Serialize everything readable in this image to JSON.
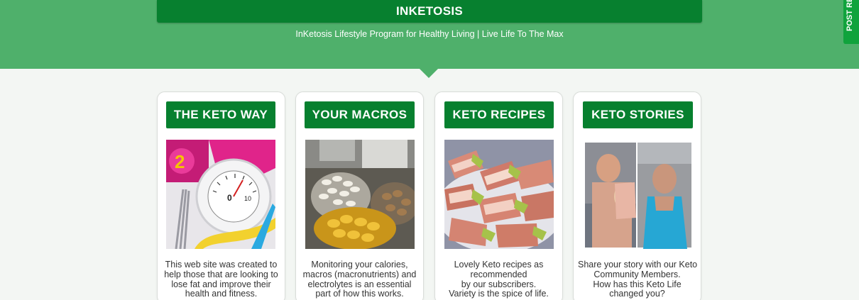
{
  "header": {
    "site_title": "INKETOSIS",
    "tagline": "InKetosis Lifestyle Program for Healthy Living | Live Life To The Max",
    "side_tab_label": "POST RE"
  },
  "colors": {
    "header_green": "#4fb06b",
    "dark_green": "#07802f",
    "tab_green": "#10a33c",
    "page_bg": "#f3f6f3"
  },
  "cards": [
    {
      "title": "THE KETO WAY",
      "image": "bathroom-scale-dumbbell-tape-measure-photo",
      "text_lines": [
        "This web site was created to",
        "help those that are looking to",
        "lose fat and improve their",
        "health and fitness."
      ]
    },
    {
      "title": "YOUR MACROS",
      "image": "supplement-capsules-nuts-photo",
      "text_lines": [
        "Monitoring your calories,",
        "macros (macronutrients) and",
        "electrolytes is an essential",
        "part of how this works."
      ]
    },
    {
      "title": "KETO RECIPES",
      "image": "bacon-wrapped-avocado-photo",
      "text_lines": [
        "Lovely Keto recipes as",
        "recommended",
        "by our subscribers.",
        "Variety is the spice of life."
      ]
    },
    {
      "title": "KETO STORIES",
      "image": "before-after-man-photos",
      "text_lines": [
        "Share your story with our Keto",
        "Community Members.",
        "How has this Keto Life",
        "changed you?"
      ]
    }
  ]
}
